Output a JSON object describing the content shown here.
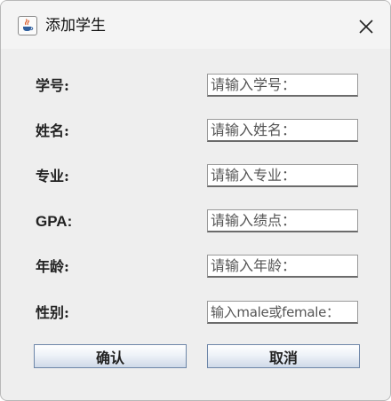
{
  "window": {
    "title": "添加学生",
    "icon": "java-cup-icon",
    "close_icon": "close-icon"
  },
  "form": {
    "fields": [
      {
        "label": "学号:",
        "placeholder": "请输入学号："
      },
      {
        "label": "姓名:",
        "placeholder": "请输入姓名："
      },
      {
        "label": "专业:",
        "placeholder": "请输入专业："
      },
      {
        "label": "GPA:",
        "placeholder": "请输入绩点："
      },
      {
        "label": "年龄:",
        "placeholder": "请输入年龄："
      },
      {
        "label": "性别:",
        "placeholder": "输入male或female："
      }
    ]
  },
  "buttons": {
    "confirm_label": "确认",
    "cancel_label": "取消"
  },
  "colors": {
    "window_bg": "#eeeeee",
    "button_border": "#6d86a8"
  }
}
